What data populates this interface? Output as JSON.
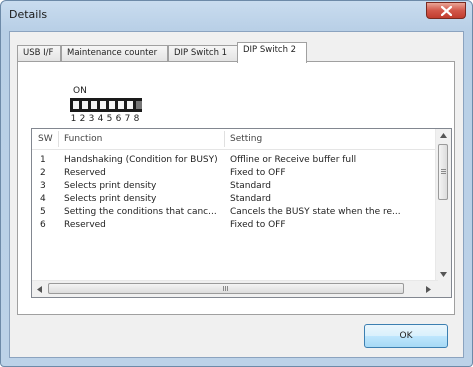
{
  "window": {
    "title": "Details"
  },
  "tabs": [
    {
      "label": "USB I/F",
      "active": false
    },
    {
      "label": "Maintenance counter",
      "active": false
    },
    {
      "label": "DIP Switch 1",
      "active": false
    },
    {
      "label": "DIP Switch 2",
      "active": true
    }
  ],
  "dip": {
    "on_label": "ON",
    "numbers": [
      "1",
      "2",
      "3",
      "4",
      "5",
      "6",
      "7",
      "8"
    ],
    "states": [
      "on",
      "on",
      "on",
      "on",
      "on",
      "on",
      "on",
      "off"
    ]
  },
  "table": {
    "columns": [
      "SW",
      "Function",
      "Setting"
    ],
    "rows": [
      {
        "sw": "1",
        "function": "Handshaking (Condition for BUSY)",
        "setting": "Offline or Receive buffer full"
      },
      {
        "sw": "2",
        "function": "Reserved",
        "setting": "Fixed to OFF"
      },
      {
        "sw": "3",
        "function": "Selects print density",
        "setting": "Standard"
      },
      {
        "sw": "4",
        "function": "Selects print density",
        "setting": "Standard"
      },
      {
        "sw": "5",
        "function": "Setting the conditions that canc...",
        "setting": "Cancels the BUSY state when the re..."
      },
      {
        "sw": "6",
        "function": "Reserved",
        "setting": "Fixed to OFF"
      }
    ]
  },
  "buttons": {
    "ok": "OK"
  }
}
